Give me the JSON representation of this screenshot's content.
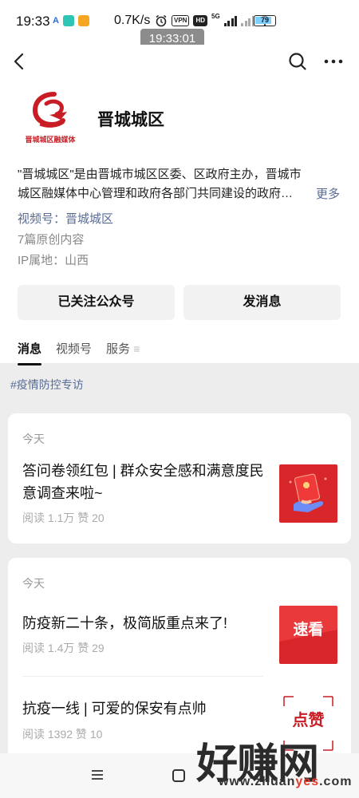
{
  "status_bar": {
    "time": "19:33",
    "net_speed": "0.7K/s",
    "badges": [
      "VPN",
      "HD"
    ],
    "network": "5G",
    "battery": "79",
    "time_toast": "19:33:01"
  },
  "nav": {
    "back_icon": "chevron-left-icon",
    "search_icon": "search-icon",
    "more_icon": "more-horizontal-icon"
  },
  "profile": {
    "logo_text": "晋城城区融媒体",
    "name": "晋城城区",
    "description": "\"晋城城区\"是由晋城市城区区委、区政府主办，晋城市城区融媒体中心管理和政府各部门共同建设的政府…",
    "more": "更多",
    "channels_label": "视频号：",
    "channels_value": "晋城城区",
    "original_count": "7篇原创内容",
    "ip_location": "IP属地：山西",
    "followed_button": "已关注公众号",
    "message_button": "发消息",
    "tabs": [
      "消息",
      "视频号",
      "服务"
    ]
  },
  "topic_tag": "#疫情防控专访",
  "cards": [
    {
      "date": "今天",
      "articles": [
        {
          "title": "答问卷领红包 | 群众安全感和满意度民意调查来啦~",
          "stats": "阅读 1.1万  赞 20"
        }
      ]
    },
    {
      "date": "今天",
      "articles": [
        {
          "title": "防疫新二十条，极简版重点来了!",
          "stats": "阅读 1.4万  赞 29",
          "thumb_text": "速看"
        },
        {
          "title": "抗疫一线 | 可爱的保安有点帅",
          "stats": "阅读 1392  赞 10",
          "thumb_text": "点赞"
        }
      ]
    }
  ],
  "watermark": {
    "big": "好赚网",
    "url_prefix": "www.zhuan",
    "url_red": "yes",
    "url_suffix": ".com"
  },
  "colors": {
    "link": "#576b95",
    "brand_red": "#c81d25",
    "background": "#ededed"
  }
}
